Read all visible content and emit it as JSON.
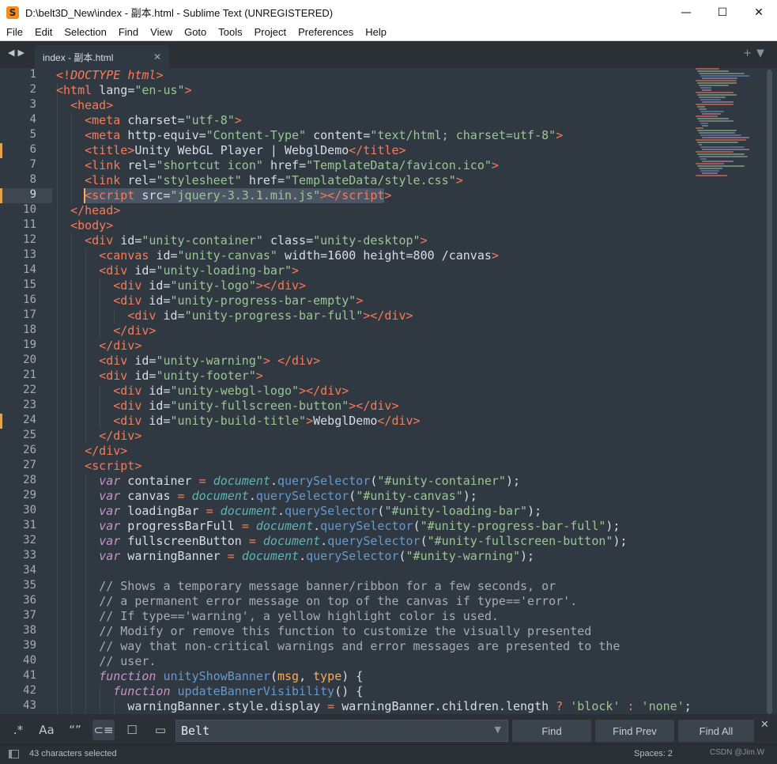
{
  "window": {
    "title": "D:\\belt3D_New\\index - 副本.html - Sublime Text (UNREGISTERED)",
    "app_icon_glyph": "S",
    "minimize": "—",
    "maximize": "☐",
    "close": "✕"
  },
  "menu": [
    "File",
    "Edit",
    "Selection",
    "Find",
    "View",
    "Goto",
    "Tools",
    "Project",
    "Preferences",
    "Help"
  ],
  "tabs": {
    "nav_arrows": "◀▶",
    "active_label": "index - 副本.html",
    "close_glyph": "✕",
    "right_controls": "+▼"
  },
  "editor": {
    "current_line": 9,
    "modified_lines": [
      6,
      9,
      24
    ],
    "colors": {
      "background": "#303841",
      "tag": "#f97b58",
      "string": "#99c794",
      "keyword": "#c695c6",
      "function": "#6699cc",
      "comment": "#a6acb3"
    }
  },
  "find": {
    "options": {
      "regex": ".*",
      "case": "Aa",
      "whole_word": "“”",
      "wrap": "⊂≡",
      "in_selection": "☐",
      "highlight": "▭"
    },
    "value": "Belt",
    "dropdown": "▼",
    "find_label": "Find",
    "find_prev_label": "Find Prev",
    "find_all_label": "Find All",
    "close": "✕"
  },
  "status": {
    "selection": "43 characters selected",
    "indent": "Spaces: 2",
    "watermark": "CSDN @Jim.W"
  }
}
